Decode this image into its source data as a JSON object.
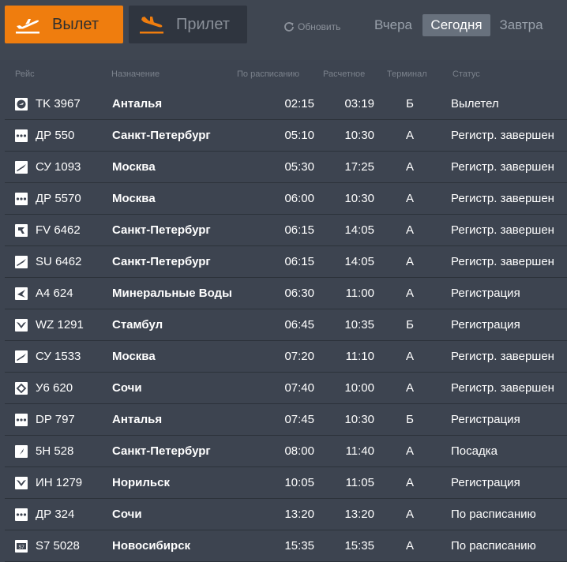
{
  "tabs": {
    "departure": {
      "label": "Вылет",
      "icon": "plane-takeoff-icon"
    },
    "arrival": {
      "label": "Прилет",
      "icon": "plane-landing-icon"
    }
  },
  "refresh": {
    "label": "Обновить",
    "icon": "refresh-icon"
  },
  "days": {
    "yesterday": "Вчера",
    "today": "Сегодня",
    "tomorrow": "Завтра",
    "selected": "Сегодня"
  },
  "columns": {
    "flight": "Рейс",
    "destination": "Назначение",
    "scheduled": "По расписанию",
    "estimated": "Расчетное",
    "terminal": "Терминал",
    "status": "Статус"
  },
  "colors": {
    "accent": "#ef7d0e",
    "background": "#3d4450",
    "divider": "#2c323a"
  },
  "flights": [
    {
      "flight": "TK 3967",
      "destination": "Анталья",
      "scheduled": "02:15",
      "estimated": "03:19",
      "terminal": "Б",
      "status": "Вылетел",
      "logo": "turkish-airlines-logo-icon"
    },
    {
      "flight": "ДР 550",
      "destination": "Санкт-Петербург",
      "scheduled": "05:10",
      "estimated": "10:30",
      "terminal": "А",
      "status": "Регистр. завершен",
      "logo": "pobeda-logo-icon"
    },
    {
      "flight": "СУ 1093",
      "destination": "Москва",
      "scheduled": "05:30",
      "estimated": "17:25",
      "terminal": "А",
      "status": "Регистр. завершен",
      "logo": "aeroflot-logo-icon"
    },
    {
      "flight": "ДР 5570",
      "destination": "Москва",
      "scheduled": "06:00",
      "estimated": "10:30",
      "terminal": "А",
      "status": "Регистр. завершен",
      "logo": "pobeda-logo-icon"
    },
    {
      "flight": "FV 6462",
      "destination": "Санкт-Петербург",
      "scheduled": "06:15",
      "estimated": "14:05",
      "terminal": "А",
      "status": "Регистр. завершен",
      "logo": "rossiya-logo-icon"
    },
    {
      "flight": "SU 6462",
      "destination": "Санкт-Петербург",
      "scheduled": "06:15",
      "estimated": "14:05",
      "terminal": "А",
      "status": "Регистр. завершен",
      "logo": "aeroflot-logo-icon"
    },
    {
      "flight": "A4 624",
      "destination": "Минеральные Воды",
      "scheduled": "06:30",
      "estimated": "11:00",
      "terminal": "А",
      "status": "Регистрация",
      "logo": "azimuth-logo-icon"
    },
    {
      "flight": "WZ 1291",
      "destination": "Стамбул",
      "scheduled": "06:45",
      "estimated": "10:35",
      "terminal": "Б",
      "status": "Регистрация",
      "logo": "red-wings-logo-icon"
    },
    {
      "flight": "СУ 1533",
      "destination": "Москва",
      "scheduled": "07:20",
      "estimated": "11:10",
      "terminal": "А",
      "status": "Регистр. завершен",
      "logo": "aeroflot-logo-icon"
    },
    {
      "flight": "У6 620",
      "destination": "Сочи",
      "scheduled": "07:40",
      "estimated": "10:00",
      "terminal": "А",
      "status": "Регистр. завершен",
      "logo": "ural-airlines-logo-icon"
    },
    {
      "flight": "DP 797",
      "destination": "Анталья",
      "scheduled": "07:45",
      "estimated": "10:30",
      "terminal": "Б",
      "status": "Регистрация",
      "logo": "pobeda-logo-icon"
    },
    {
      "flight": "5H 528",
      "destination": "Санкт-Петербург",
      "scheduled": "08:00",
      "estimated": "11:40",
      "terminal": "А",
      "status": "Посадка",
      "logo": "generic-airline-logo-icon"
    },
    {
      "flight": "ИН 1279",
      "destination": "Норильск",
      "scheduled": "10:05",
      "estimated": "11:05",
      "terminal": "А",
      "status": "Регистрация",
      "logo": "nordwind-logo-icon"
    },
    {
      "flight": "ДР 324",
      "destination": "Сочи",
      "scheduled": "13:20",
      "estimated": "13:20",
      "terminal": "А",
      "status": "По расписанию",
      "logo": "pobeda-logo-icon"
    },
    {
      "flight": "S7 5028",
      "destination": "Новосибирск",
      "scheduled": "15:35",
      "estimated": "15:35",
      "terminal": "А",
      "status": "По расписанию",
      "logo": "s7-logo-icon"
    }
  ]
}
